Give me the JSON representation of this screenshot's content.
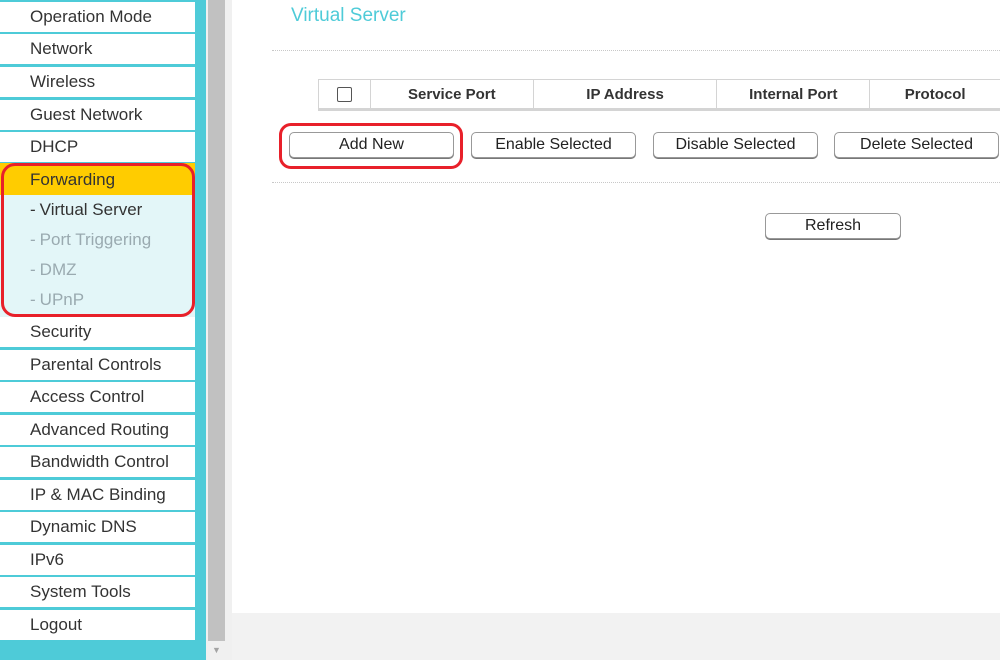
{
  "sidebar": {
    "items_top": [
      {
        "label": "Operation Mode"
      },
      {
        "label": "Network"
      },
      {
        "label": "Wireless"
      },
      {
        "label": "Guest Network"
      },
      {
        "label": "DHCP"
      }
    ],
    "forwarding": {
      "label": "Forwarding",
      "sub_items": [
        {
          "label": "Virtual Server",
          "active": true
        },
        {
          "label": "Port Triggering",
          "active": false
        },
        {
          "label": "DMZ",
          "active": false
        },
        {
          "label": "UPnP",
          "active": false
        }
      ],
      "dash": "-"
    },
    "items_bottom": [
      {
        "label": "Security"
      },
      {
        "label": "Parental Controls"
      },
      {
        "label": "Access Control"
      },
      {
        "label": "Advanced Routing"
      },
      {
        "label": "Bandwidth Control"
      },
      {
        "label": "IP & MAC Binding"
      },
      {
        "label": "Dynamic DNS"
      },
      {
        "label": "IPv6"
      },
      {
        "label": "System Tools"
      },
      {
        "label": "Logout"
      }
    ]
  },
  "scrollbar": {
    "down_arrow_icon": "▼"
  },
  "main": {
    "title": "Virtual Server",
    "table": {
      "columns": [
        "Service Port",
        "IP Address",
        "Internal Port",
        "Protocol"
      ],
      "select_all_checked": false
    },
    "buttons": {
      "add_new": "Add New",
      "enable_selected": "Enable Selected",
      "disable_selected": "Disable Selected",
      "delete_selected": "Delete Selected",
      "refresh": "Refresh"
    }
  },
  "colors": {
    "sidebar_bg": "#4ecbd8",
    "active_section": "#ffcc00",
    "annotation": "#e8202a",
    "title": "#4ecbd8"
  }
}
